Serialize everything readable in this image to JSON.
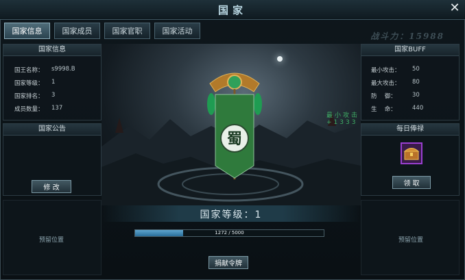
{
  "window": {
    "title": "国家",
    "close_symbol": "✕"
  },
  "tabs": [
    {
      "label": "国家信息",
      "active": true
    },
    {
      "label": "国家成员",
      "active": false
    },
    {
      "label": "国家官职",
      "active": false
    },
    {
      "label": "国家活动",
      "active": false
    }
  ],
  "power": "战斗力：15988",
  "info": {
    "title": "国家信息",
    "rows": [
      {
        "label": "国王名称：",
        "value": "s9998.B"
      },
      {
        "label": "国家等级：",
        "value": "1"
      },
      {
        "label": "国家排名：",
        "value": "3"
      },
      {
        "label": "成员数量：",
        "value": "137"
      }
    ]
  },
  "notice": {
    "title": "国家公告",
    "button": "修 改"
  },
  "buff": {
    "title": "国家BUFF",
    "rows": [
      {
        "label": "最小攻击：",
        "value": "50"
      },
      {
        "label": "最大攻击：",
        "value": "80"
      },
      {
        "label": "防　 御：",
        "value": "30"
      },
      {
        "label": "生　 命：",
        "value": "440"
      }
    ]
  },
  "salary": {
    "title": "每日俸禄",
    "button": "领 取"
  },
  "banner": {
    "glyph": "蜀"
  },
  "scene_text": "最小攻击+1333",
  "level": {
    "label": "国家等级：1"
  },
  "progress": {
    "text": "1272 / 5000",
    "current": 1272,
    "max": 5000
  },
  "reserved_left": "预留位置",
  "reserved_right": "预留位置",
  "donate_button": "捐献令牌",
  "colors": {
    "accent": "#2a6e9a",
    "banner_green": "#2f7a3c",
    "gold": "#c8952f"
  }
}
